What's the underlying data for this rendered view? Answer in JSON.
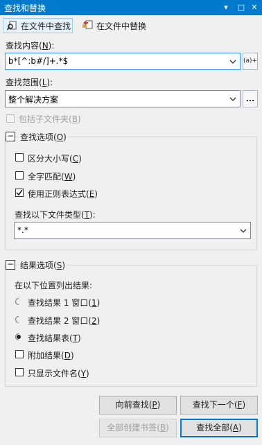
{
  "window": {
    "title": "查找和替换",
    "dropdown_glyph": "▾",
    "maximize_glyph": "□",
    "close_glyph": "✕"
  },
  "modes": {
    "find_in_files": "在文件中查找",
    "replace_in_files": "在文件中替换"
  },
  "find": {
    "label_prefix": "查找内容(",
    "label_key": "N",
    "label_suffix": "):",
    "value": "b*[^:b#/]+.*$",
    "regex_button": "(a)+"
  },
  "scope": {
    "label_prefix": "查找范围(",
    "label_key": "L",
    "label_suffix": "):",
    "value": "整个解决方案",
    "browse_button": "..."
  },
  "include_subfolders": {
    "prefix": "包括子文件夹(",
    "key": "B",
    "suffix": ")",
    "checked": false,
    "enabled": false
  },
  "find_options": {
    "title_prefix": "查找选项(",
    "title_key": "O",
    "title_suffix": ")",
    "collapse_glyph": "−",
    "match_case": {
      "prefix": "区分大小写(",
      "key": "C",
      "suffix": ")",
      "checked": false
    },
    "whole_word": {
      "prefix": "全字匹配(",
      "key": "W",
      "suffix": ")",
      "checked": false
    },
    "use_regex": {
      "prefix": "使用正则表达式(",
      "key": "E",
      "suffix": ")",
      "checked": true
    },
    "file_types_label_prefix": "查找以下文件类型(",
    "file_types_label_key": "T",
    "file_types_label_suffix": "):",
    "file_types_value": "*.*"
  },
  "result_options": {
    "title_prefix": "结果选项(",
    "title_key": "S",
    "title_suffix": ")",
    "collapse_glyph": "−",
    "list_label": "在以下位置列出结果:",
    "radio1": {
      "prefix": "查找结果 1 窗口(",
      "key": "1",
      "suffix": ")",
      "selected": false
    },
    "radio2": {
      "prefix": "查找结果 2 窗口(",
      "key": "2",
      "suffix": ")",
      "selected": false
    },
    "radio3": {
      "prefix": "查找结果表(",
      "key": "T",
      "suffix": ")",
      "selected": true
    },
    "append": {
      "prefix": "附加结果(",
      "key": "D",
      "suffix": ")",
      "checked": false
    },
    "filenames_only": {
      "prefix": "只显示文件名(",
      "key": "Y",
      "suffix": ")",
      "checked": false
    }
  },
  "buttons": {
    "find_previous": {
      "prefix": "向前查找(",
      "key": "P",
      "suffix": ")"
    },
    "find_next": {
      "prefix": "查找下一个(",
      "key": "F",
      "suffix": ")"
    },
    "bookmark_all": {
      "prefix": "全部创建书签(",
      "key": "B",
      "suffix": ")"
    },
    "find_all": {
      "prefix": "查找全部(",
      "key": "A",
      "suffix": ")"
    }
  },
  "colors": {
    "titlebar": "#007acc",
    "focus_border": "#3399ff",
    "primary_button_border": "#0078d7"
  }
}
